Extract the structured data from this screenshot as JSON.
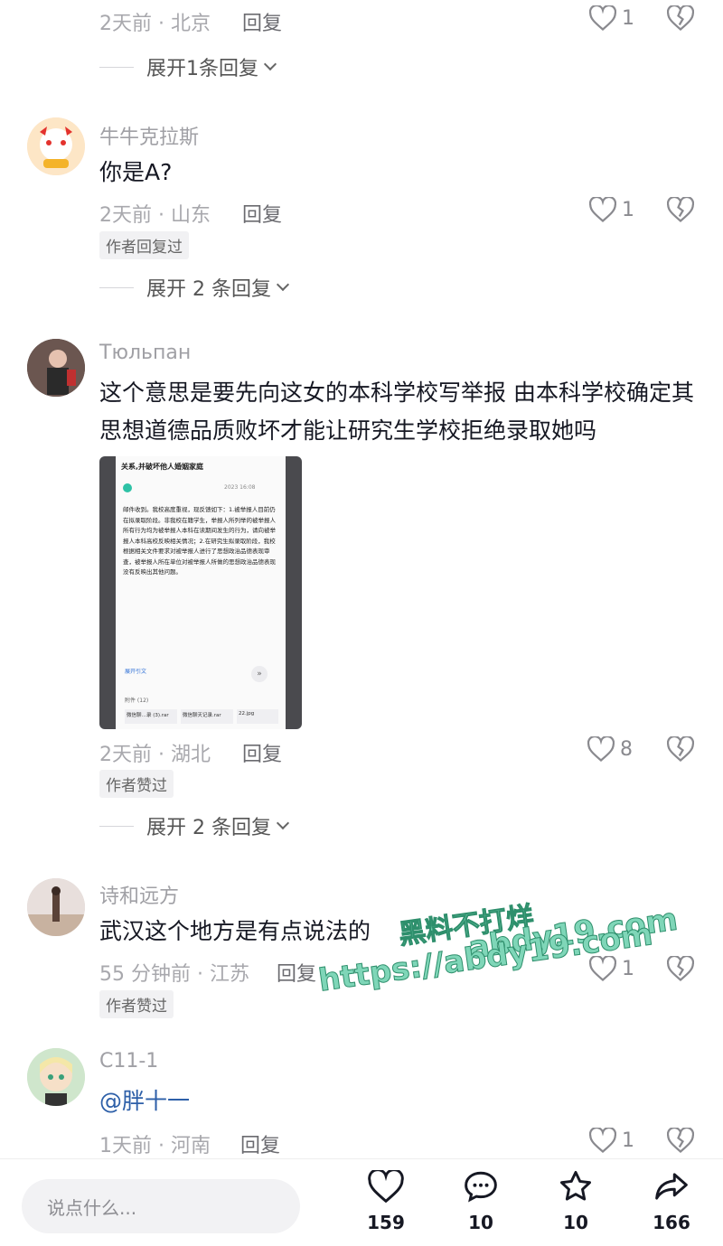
{
  "comments": [
    {
      "time": "2天前 · 北京",
      "reply": "回复",
      "likes": "1",
      "expand": "展开1条回复"
    },
    {
      "user": "牛牛克拉斯",
      "text": "你是A?",
      "time": "2天前 · 山东",
      "reply": "回复",
      "likes": "1",
      "badge": "作者回复过",
      "expand": "展开 2 条回复"
    },
    {
      "user": "Тюльпан",
      "text": "这个意思是要先向这女的本科学校写举报 由本科学校确定其思想道德品质败坏才能让研究生学校拒绝录取她吗",
      "time": "2天前 · 湖北",
      "reply": "回复",
      "likes": "8",
      "badge": "作者赞过",
      "expand": "展开 2 条回复",
      "image": {
        "header": "关系,并破坏他人婚姻家庭",
        "date": "2023 16:08",
        "body": "邮件收到。我校高度重视，现反馈如下：1.被举报人目前仍在拟录取阶段。非我校在籍学生，举报人所列举的被举报人所有行为均为被举报人本科在读期间发生的行为，请向被举报人本科高校反映相关情况；2.在研究生拟录取阶段，我校根据相关文件要求对被举报人进行了思想政治品德表现审查，被举报人所在单位对被举报人所做的思想政治品德表现没有反映出其他问题。",
        "expand_label": "展开引文",
        "attach_title": "附件 (12)",
        "attachments": [
          "微信聊…录 (3).rar",
          "微信聊天记录.rar",
          "22.jpg"
        ]
      }
    },
    {
      "user": "诗和远方",
      "text": "武汉这个地方是有点说法的",
      "time": "55 分钟前 · 江苏",
      "reply": "回复",
      "likes": "1",
      "badge": "作者赞过"
    },
    {
      "user": "C11-1",
      "mention": "@胖十一",
      "time": "1天前 · 河南",
      "reply": "回复",
      "likes": "1"
    }
  ],
  "watermark": {
    "line1": "黑料不打烊",
    "line2": "abdy19.com",
    "line3": "https://abdy19.com"
  },
  "bottom_bar": {
    "placeholder": "说点什么...",
    "like_count": "159",
    "comment_count": "10",
    "star_count": "10",
    "share_count": "166"
  }
}
